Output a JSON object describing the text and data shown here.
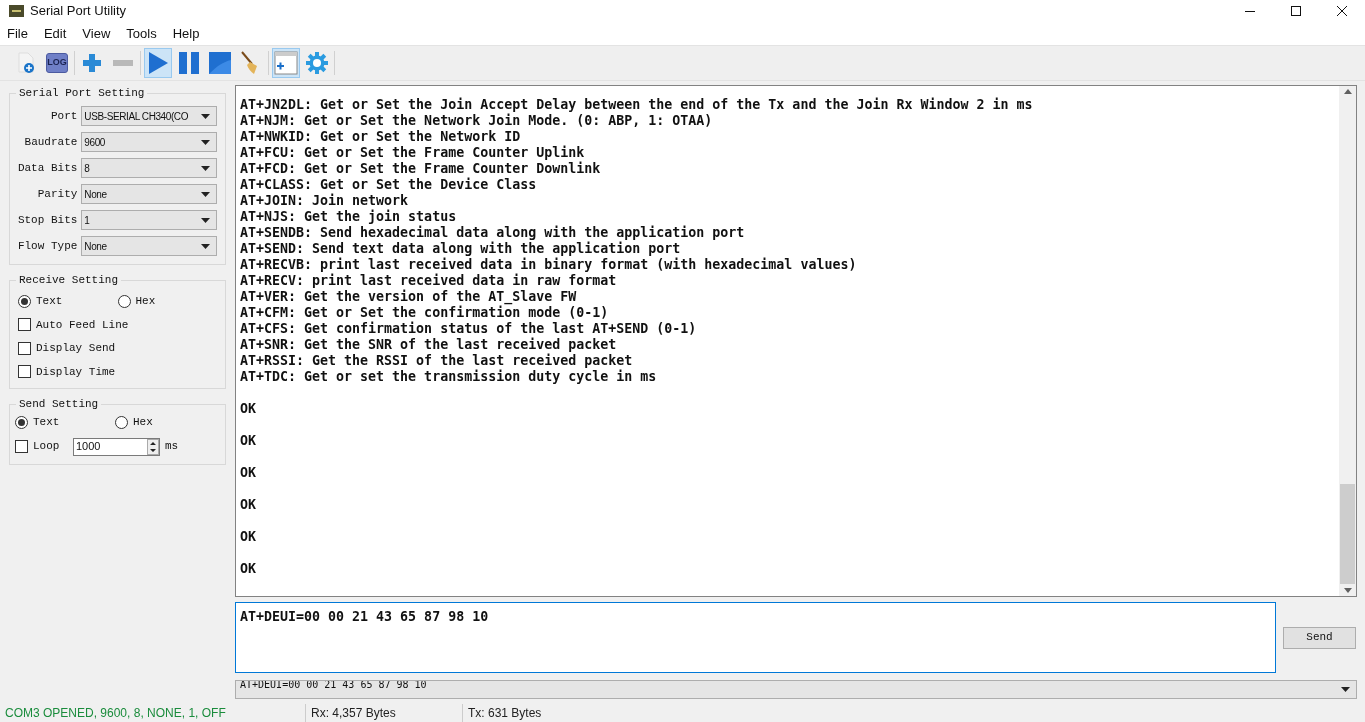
{
  "window": {
    "title": "Serial Port Utility"
  },
  "menu": [
    "File",
    "Edit",
    "View",
    "Tools",
    "Help"
  ],
  "toolbar": [
    {
      "kind": "new",
      "selected": false
    },
    {
      "kind": "log",
      "label": "LOG",
      "selected": false
    },
    {
      "kind": "plus",
      "selected": false
    },
    {
      "kind": "minus",
      "selected": false
    },
    {
      "kind": "play",
      "selected": true
    },
    {
      "kind": "pause",
      "selected": false
    },
    {
      "kind": "stop",
      "selected": false
    },
    {
      "kind": "broom",
      "selected": false
    },
    {
      "kind": "window",
      "selected": true
    },
    {
      "kind": "gear",
      "selected": false
    }
  ],
  "serial_port_setting": {
    "title": "Serial Port Setting",
    "fields": [
      {
        "label": "Port",
        "value": "USB-SERIAL CH340(CO"
      },
      {
        "label": "Baudrate",
        "value": "9600"
      },
      {
        "label": "Data Bits",
        "value": "8"
      },
      {
        "label": "Parity",
        "value": "None"
      },
      {
        "label": "Stop Bits",
        "value": "1"
      },
      {
        "label": "Flow Type",
        "value": "None"
      }
    ]
  },
  "receive_setting": {
    "title": "Receive Setting",
    "modes": [
      {
        "label": "Text",
        "selected": true
      },
      {
        "label": "Hex",
        "selected": false
      }
    ],
    "options": [
      {
        "label": "Auto Feed Line",
        "checked": false
      },
      {
        "label": "Display Send",
        "checked": false
      },
      {
        "label": "Display Time",
        "checked": false
      }
    ]
  },
  "send_setting": {
    "title": "Send Setting",
    "modes": [
      {
        "label": "Text",
        "selected": true
      },
      {
        "label": "Hex",
        "selected": false
      }
    ],
    "loop": {
      "label": "Loop",
      "checked": false,
      "value": "1000",
      "unit": "ms"
    }
  },
  "terminal": [
    {
      "kind": "line",
      "text": "AT+JN2DL: Get or Set the Join Accept Delay between the end of the Tx and the Join Rx Window 2 in ms"
    },
    {
      "kind": "line",
      "text": "AT+NJM: Get or Set the Network Join Mode. (0: ABP, 1: OTAA)"
    },
    {
      "kind": "line",
      "text": "AT+NWKID: Get or Set the Network ID"
    },
    {
      "kind": "line",
      "text": "AT+FCU: Get or Set the Frame Counter Uplink"
    },
    {
      "kind": "line",
      "text": "AT+FCD: Get or Set the Frame Counter Downlink"
    },
    {
      "kind": "line",
      "text": "AT+CLASS: Get or Set the Device Class"
    },
    {
      "kind": "line",
      "text": "AT+JOIN: Join network"
    },
    {
      "kind": "line",
      "text": "AT+NJS: Get the join status"
    },
    {
      "kind": "line",
      "text": "AT+SENDB: Send hexadecimal data along with the application port"
    },
    {
      "kind": "line",
      "text": "AT+SEND: Send text data along with the application port"
    },
    {
      "kind": "line",
      "text": "AT+RECVB: print last received data in binary format (with hexadecimal values)"
    },
    {
      "kind": "line",
      "text": "AT+RECV: print last received data in raw format"
    },
    {
      "kind": "line",
      "text": "AT+VER: Get the version of the AT_Slave FW"
    },
    {
      "kind": "line",
      "text": "AT+CFM: Get or Set the confirmation mode (0-1)"
    },
    {
      "kind": "line",
      "text": "AT+CFS: Get confirmation status of the last AT+SEND (0-1)"
    },
    {
      "kind": "line",
      "text": "AT+SNR: Get the SNR of the last received packet"
    },
    {
      "kind": "line",
      "text": "AT+RSSI: Get the RSSI of the last received packet"
    },
    {
      "kind": "line",
      "text": "AT+TDC: Get or set the transmission duty cycle in ms"
    },
    {
      "kind": "reply",
      "text": "OK"
    },
    {
      "kind": "reply",
      "text": "OK"
    },
    {
      "kind": "reply",
      "text": "OK"
    },
    {
      "kind": "reply",
      "text": "OK"
    },
    {
      "kind": "reply",
      "text": "OK"
    },
    {
      "kind": "reply",
      "text": "OK"
    }
  ],
  "send_input": {
    "value": "AT+DEUI=00 00 21 43 65 87 98 10"
  },
  "send_button": "Send",
  "history": {
    "value": "AT+DEUI=00 00 21 43 65 87 98 10"
  },
  "status_bar": [
    "COM3 OPENED, 9600, 8, NONE, 1, OFF",
    "Rx: 4,357 Bytes",
    "Tx: 631 Bytes"
  ]
}
